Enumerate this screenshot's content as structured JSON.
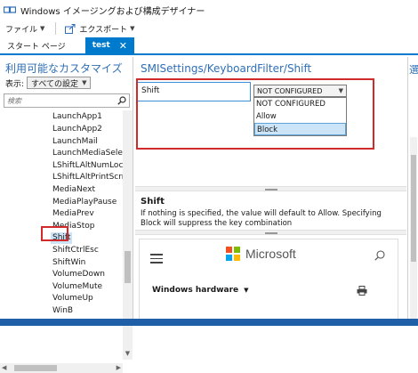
{
  "window": {
    "title": "Windows イメージングおよび構成デザイナー"
  },
  "menu": {
    "file": "ファイル",
    "export": "エクスポート"
  },
  "tabs": [
    {
      "label": "スタート ページ",
      "active": false
    },
    {
      "label": "test",
      "active": true
    }
  ],
  "left": {
    "heading": "利用可能なカスタマイズ",
    "view_label": "表示:",
    "view_value": "すべての設定",
    "search_placeholder": "検索",
    "items": [
      "LaunchApp1",
      "LaunchApp2",
      "LaunchMail",
      "LaunchMediaSelect",
      "LShiftLAltNumLock",
      "LShiftLAltPrintScrn",
      "MediaNext",
      "MediaPlayPause",
      "MediaPrev",
      "MediaStop",
      "Shift",
      "ShiftCtrlEsc",
      "ShiftWin",
      "VolumeDown",
      "VolumeMute",
      "VolumeUp",
      "WinB"
    ],
    "selected_item": "Shift"
  },
  "main": {
    "path": "SMISettings/KeyboardFilter/Shift",
    "setting_name": "Shift",
    "selected_value": "NOT CONFIGURED",
    "options": [
      "NOT CONFIGURED",
      "Allow",
      "Block"
    ],
    "hovered_option": "Block",
    "desc_title": "Shift",
    "desc_text": "If nothing is specified, the value will default to Allow.  Specifying Block will suppress the key combination"
  },
  "browser": {
    "brand": "Microsoft",
    "nav_label": "Windows hardware"
  },
  "right_edge": {
    "char": "選"
  },
  "colors": {
    "accent": "#007acc",
    "heading": "#2e6fb7",
    "highlight": "#d12a2a",
    "ms_red": "#f25022",
    "ms_green": "#7fba00",
    "ms_blue": "#00a4ef",
    "ms_yellow": "#ffb900"
  }
}
